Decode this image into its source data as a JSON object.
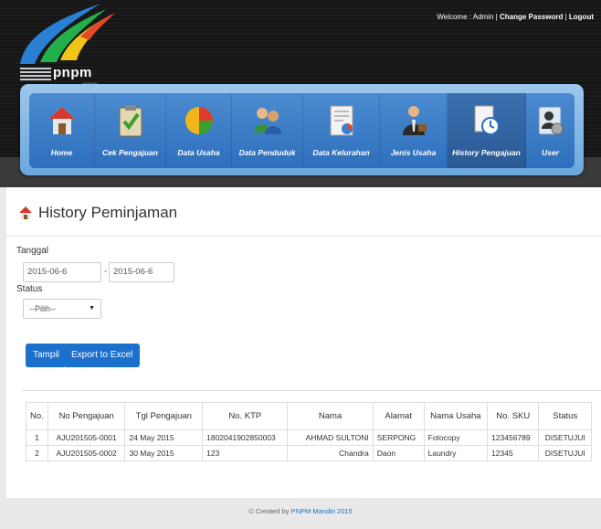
{
  "header": {
    "welcome_text": "Welcome : Admin |",
    "change_password": "Change Password",
    "sep": "|",
    "logout": "Logout",
    "logo_text": "pnpm",
    "logo_sub": "MANDIRI"
  },
  "nav": {
    "items": [
      {
        "label": "Home",
        "icon": "home-icon"
      },
      {
        "label": "Cek Pengajuan",
        "icon": "clipboard-check-icon"
      },
      {
        "label": "Data Usaha",
        "icon": "pie-chart-icon"
      },
      {
        "label": "Data Penduduk",
        "icon": "people-icon"
      },
      {
        "label": "Data Kelurahan",
        "icon": "document-chart-icon"
      },
      {
        "label": "Jenis Usaha",
        "icon": "business-person-icon"
      },
      {
        "label": "History Pengajuan",
        "icon": "history-clock-icon"
      },
      {
        "label": "User",
        "icon": "user-settings-icon"
      }
    ],
    "active": "History Pengajuan"
  },
  "page": {
    "title": "History Peminjaman"
  },
  "filters": {
    "tanggal_label": "Tanggal",
    "date_from": "2015-06-6",
    "date_sep": "-",
    "date_to": "2015-06-6",
    "status_label": "Status",
    "status_selected": "--Pilih--",
    "tampil_label": "Tampil",
    "export_label": "Export to Excel"
  },
  "table": {
    "headers": [
      "No.",
      "No Pengajuan",
      "Tgl Pengajuan",
      "No. KTP",
      "Nama",
      "Alamat",
      "Nama Usaha",
      "No. SKU",
      "Status"
    ],
    "rows": [
      [
        "1",
        "AJU201505-0001",
        "24 May 2015",
        "1802041902850003",
        "AHMAD SULTONI",
        "SERPONG",
        "Fotocopy",
        "123456789",
        "DISETUJUI"
      ],
      [
        "2",
        "AJU201505-0002",
        "30 May 2015",
        "123",
        "Chandra",
        "Daon",
        "Laundry",
        "12345",
        "DISETUJUI"
      ]
    ]
  },
  "footer": {
    "prefix": "© Created by",
    "highlight": "PNPM Mandiri 2015"
  },
  "colors": {
    "accent": "#1b6fcd",
    "nav_blue": "#3a7ec9",
    "header_dark": "#1a1a1a"
  }
}
